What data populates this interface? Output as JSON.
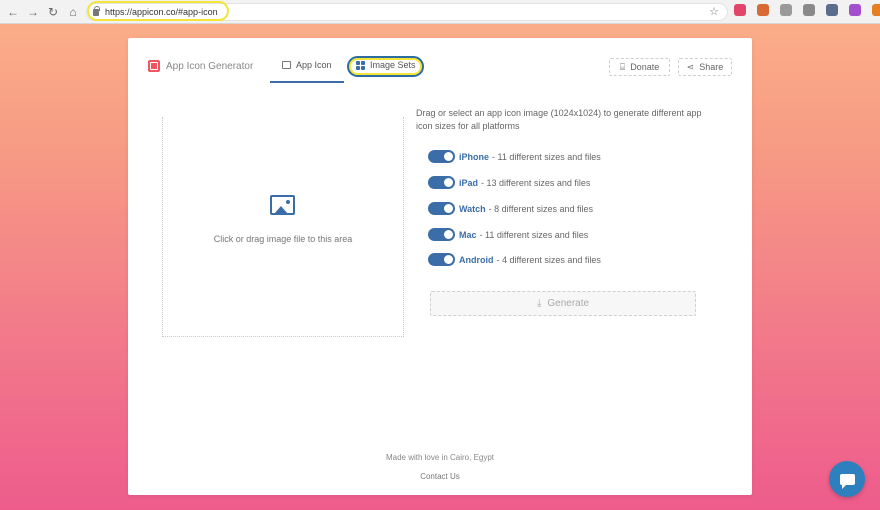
{
  "browser": {
    "url": "https://appicon.co/#app-icon",
    "nav": {
      "back": "←",
      "forward": "→",
      "reload": "↻",
      "home": "⌂"
    },
    "bookmark_icon": "☆",
    "extension_colors": [
      "#e2456a",
      "#d86b35",
      "#9a9a9a",
      "#8a8a8a",
      "#5a6d8c",
      "#a34dcf",
      "#e67e22"
    ]
  },
  "header": {
    "brand": "App Icon Generator",
    "tabs": [
      {
        "label": "App Icon",
        "active": true
      },
      {
        "label": "Image Sets",
        "active": false
      }
    ],
    "donate_label": "Donate",
    "share_label": "Share"
  },
  "dropzone": {
    "text": "Click or drag image file to this area",
    "icon": "image-icon"
  },
  "panel": {
    "description": "Drag or select an app icon image (1024x1024) to generate different app icon sizes for all platforms",
    "platforms": [
      {
        "name": "iPhone",
        "detail": "- 11 different sizes and files",
        "enabled": true
      },
      {
        "name": "iPad",
        "detail": "- 13 different sizes and files",
        "enabled": true
      },
      {
        "name": "Watch",
        "detail": "- 8 different sizes and files",
        "enabled": true
      },
      {
        "name": "Mac",
        "detail": "- 11 different sizes and files",
        "enabled": true
      },
      {
        "name": "Android",
        "detail": "- 4 different sizes and files",
        "enabled": true
      }
    ],
    "generate_label": "Generate"
  },
  "footer": {
    "made_with": "Made with love in Cairo, Egypt",
    "contact": "Contact Us"
  },
  "colors": {
    "accent": "#3b6ea8",
    "brand": "#f0545e",
    "chat": "#2d7fbe"
  }
}
